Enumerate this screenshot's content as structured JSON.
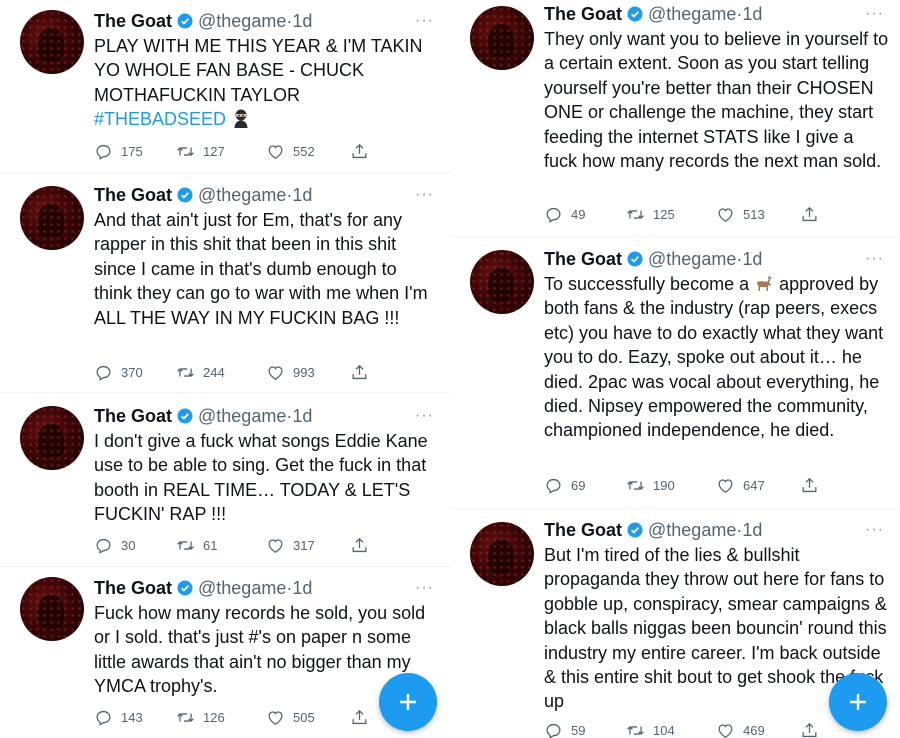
{
  "icons": {
    "verified": "verified-badge-icon",
    "reply": "reply-icon",
    "retweet": "retweet-icon",
    "like": "heart-icon",
    "share": "share-icon",
    "more": "more-options-icon",
    "compose": "compose-plus-icon"
  },
  "colors": {
    "accent": "#1d9bf0",
    "secondary_text": "#536471"
  },
  "left": [
    {
      "name": "The Goat",
      "handle": "@thegame",
      "time": "1d",
      "text": "PLAY WITH ME THIS YEAR & I'M TAKIN YO WHOLE FAN BASE - CHUCK MOTHAFUCKIN TAYLOR",
      "hashtag": "#THEBADSEED",
      "emoji": "ninja",
      "reply": "175",
      "retweet": "127",
      "like": "552"
    },
    {
      "name": "The Goat",
      "handle": "@thegame",
      "time": "1d",
      "text": "And that ain't just for Em, that's for any rapper in this shit that been in this shit since I came in that's dumb enough to think they can go to war with me when I'm ALL THE WAY IN MY FUCKIN BAG !!!",
      "reply": "370",
      "retweet": "244",
      "like": "993"
    },
    {
      "name": "The Goat",
      "handle": "@thegame",
      "time": "1d",
      "text": "I don't give a fuck what songs Eddie Kane use to be able to sing. Get the fuck in that booth in REAL TIME… TODAY & LET'S FUCKIN' RAP !!!",
      "reply": "30",
      "retweet": "61",
      "like": "317"
    },
    {
      "name": "The Goat",
      "handle": "@thegame",
      "time": "1d",
      "text": "Fuck how many records he sold, you sold or I sold. that's just #'s on paper n some little awards that ain't no bigger than my YMCA trophy's.",
      "reply": "143",
      "retweet": "126",
      "like": "505"
    }
  ],
  "right": [
    {
      "name": "The Goat",
      "handle": "@thegame",
      "time": "1d",
      "text": "They only want you to believe in yourself to a certain extent. Soon as you start telling yourself you're better than their CHOSEN ONE or challenge the machine, they start feeding the internet STATS like I give a fuck how many records the next man sold.",
      "reply": "49",
      "retweet": "125",
      "like": "513"
    },
    {
      "name": "The Goat",
      "handle": "@thegame",
      "time": "1d",
      "text_before": "To successfully become a ",
      "emoji": "goat",
      "text": " approved by both fans & the industry (rap peers, execs etc) you have to do exactly what they want you to do. Eazy, spoke out about it… he died. 2pac was vocal about everything, he died. Nipsey empowered the community, championed independence, he died.",
      "reply": "69",
      "retweet": "190",
      "like": "647"
    },
    {
      "name": "The Goat",
      "handle": "@thegame",
      "time": "1d",
      "text": "But I'm tired of the lies & bullshit propaganda they throw out here for fans to gobble up, conspiracy, smear campaigns & black balls niggas been bouncin' round this industry my entire career. I'm back outside & this entire shit bout to get shook the fuck up",
      "reply": "59",
      "retweet": "104",
      "like": "469"
    }
  ]
}
